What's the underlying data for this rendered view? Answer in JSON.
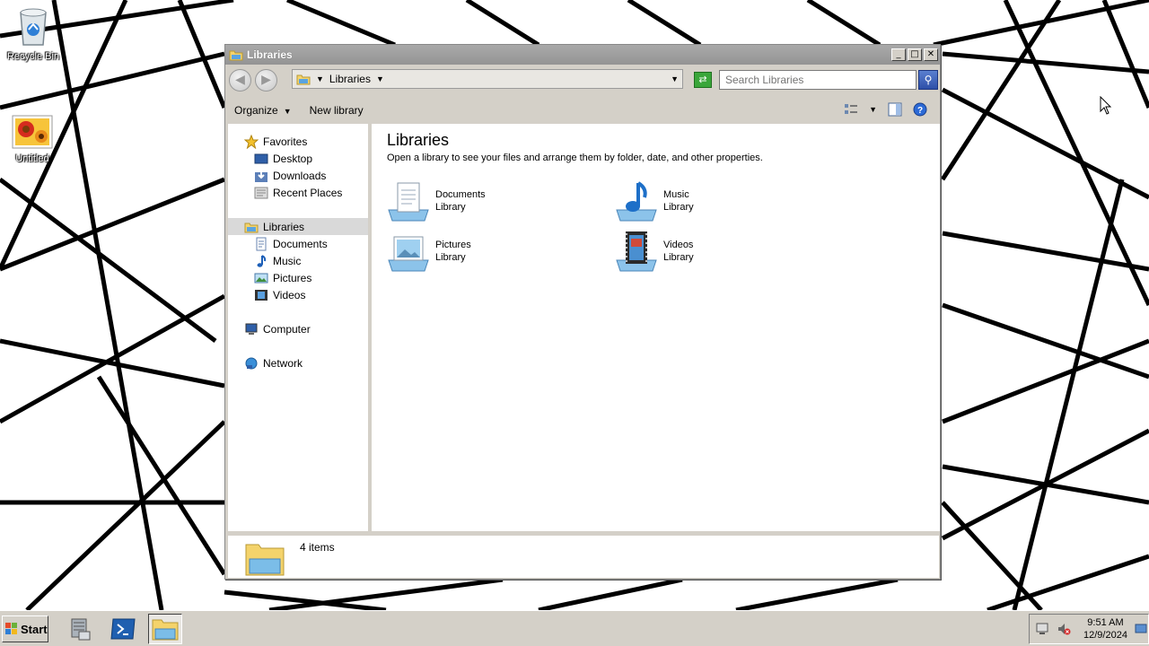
{
  "desktop": {
    "icons": [
      {
        "label": "Recycle Bin",
        "icon": "recycle-bin-icon"
      },
      {
        "label": "Untitled",
        "icon": "image-file-icon"
      }
    ]
  },
  "window": {
    "title": "Libraries",
    "address": {
      "crumb": "Libraries"
    },
    "search": {
      "placeholder": "Search Libraries"
    },
    "toolbar": {
      "organize_label": "Organize",
      "new_library_label": "New library"
    },
    "nav": {
      "favorites": "Favorites",
      "desktop": "Desktop",
      "downloads": "Downloads",
      "recent_places": "Recent Places",
      "libraries": "Libraries",
      "documents": "Documents",
      "music": "Music",
      "pictures": "Pictures",
      "videos": "Videos",
      "computer": "Computer",
      "network": "Network"
    },
    "content": {
      "heading": "Libraries",
      "description": "Open a library to see your files and arrange them by folder, date, and other properties.",
      "libraries": [
        {
          "name": "Documents",
          "type": "Library",
          "icon": "documents-library-icon"
        },
        {
          "name": "Music",
          "type": "Library",
          "icon": "music-library-icon"
        },
        {
          "name": "Pictures",
          "type": "Library",
          "icon": "pictures-library-icon"
        },
        {
          "name": "Videos",
          "type": "Library",
          "icon": "videos-library-icon"
        }
      ]
    },
    "details": {
      "count": "4 items"
    }
  },
  "taskbar": {
    "start_label": "Start",
    "clock": {
      "time": "9:51 AM",
      "date": "12/9/2024"
    }
  }
}
